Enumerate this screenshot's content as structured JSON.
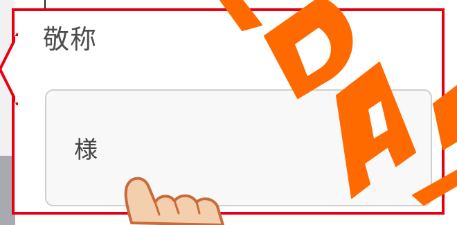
{
  "field": {
    "label": "敬称",
    "selected_value": "様"
  },
  "icons": {
    "dropdown": "chevron-down-icon",
    "pointer": "pointing-hand-icon"
  },
  "colors": {
    "highlight": "#e60012",
    "watermark": "#ff6a00",
    "label_text": "#4d4d4d",
    "select_bg": "#f8f8f8",
    "select_border": "#cfcfcf",
    "hand_fill": "#f3cfae",
    "hand_stroke": "#c86a3a"
  }
}
